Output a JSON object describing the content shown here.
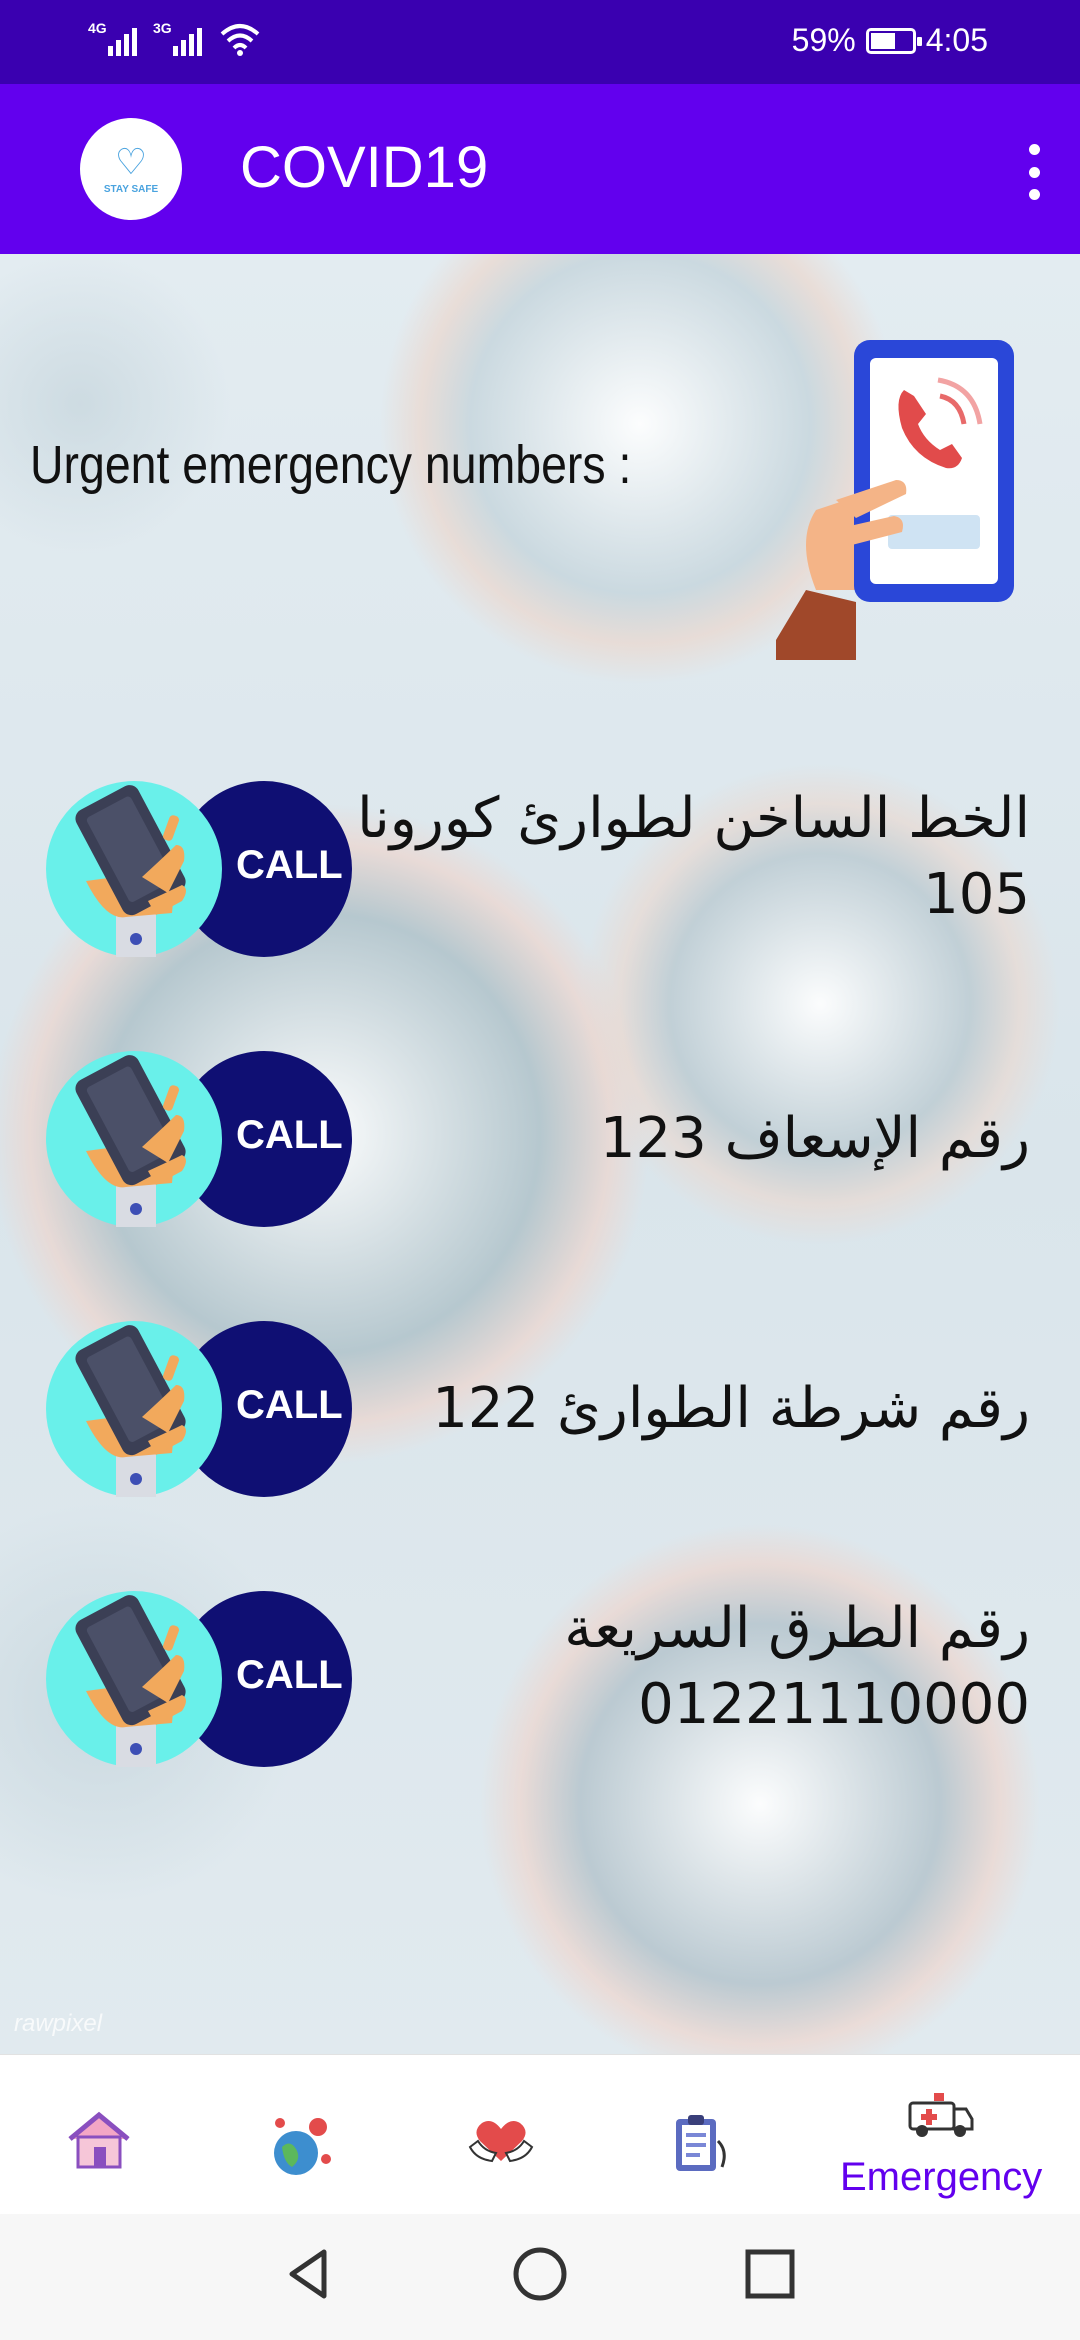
{
  "status_bar": {
    "network_1": "4G",
    "network_2": "3G",
    "battery_percent": "59%",
    "battery_level": 0.59,
    "time": "4:05"
  },
  "app_bar": {
    "logo_text": "STAY SAFE",
    "title": "COVID19",
    "menu_icon": "more-vert-icon"
  },
  "content": {
    "section_title": "Urgent emergency numbers :",
    "watermark": "rawpixel",
    "call_label": "CALL",
    "rows": [
      {
        "line1": "الخط الساخن لطوارئ كورونا",
        "line2": "105"
      },
      {
        "line1": "رقم الإسعاف 123",
        "line2": ""
      },
      {
        "line1": "رقم شرطة الطوارئ 122",
        "line2": ""
      },
      {
        "line1": "رقم الطرق السريعة",
        "line2": "01221110000"
      }
    ]
  },
  "bottom_nav": {
    "items": [
      {
        "icon": "home-icon",
        "label": ""
      },
      {
        "icon": "globe-virus-icon",
        "label": ""
      },
      {
        "icon": "heart-hands-icon",
        "label": ""
      },
      {
        "icon": "clipboard-icon",
        "label": ""
      },
      {
        "icon": "ambulance-icon",
        "label": "Emergency"
      }
    ],
    "active_color": "#6200ee"
  },
  "colors": {
    "status_bar": "#3a00b0",
    "app_bar": "#6200ee",
    "call_dark": "#0f0f73",
    "call_cyan": "#69f0ea"
  }
}
